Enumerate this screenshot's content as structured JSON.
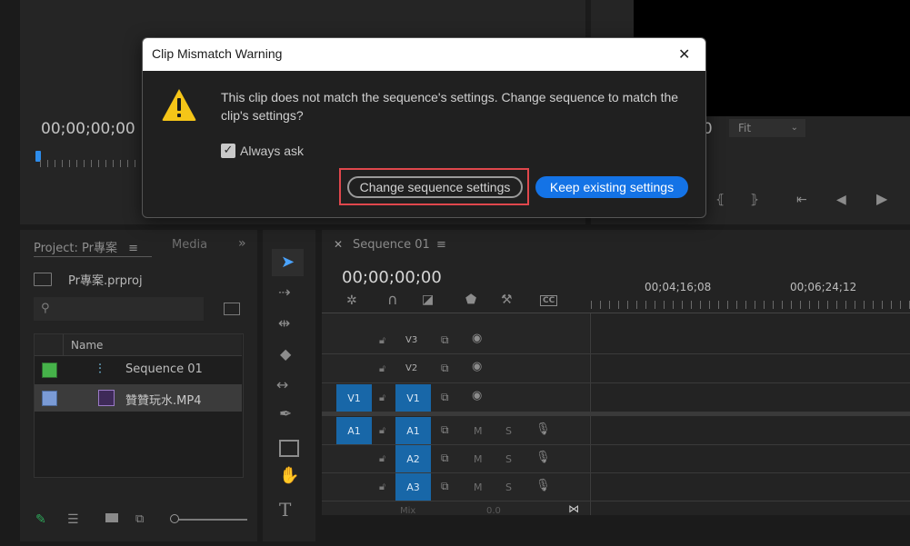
{
  "source_monitor": {
    "timecode": "00;00;00;00"
  },
  "program_monitor": {
    "timecode_partial": "00",
    "zoom": "Fit"
  },
  "project": {
    "tab_label": "Project: Pr專案",
    "tab_media": "Media",
    "file_name": "Pr專案.prproj",
    "column_name": "Name",
    "items": [
      {
        "name": "Sequence 01",
        "color": "#46b34a"
      },
      {
        "name": "贊贊玩水.MP4",
        "color": "#7a9bd6"
      }
    ]
  },
  "timeline": {
    "tab_label": "Sequence 01",
    "timecode": "00;00;00;00",
    "ruler_marks": [
      "00;04;16;08",
      "00;06;24;12"
    ],
    "video_tracks": [
      "V3",
      "V2",
      "V1"
    ],
    "audio_tracks": [
      "A1",
      "A2",
      "A3"
    ],
    "source_v": "V1",
    "source_a": "A1",
    "mute_label": "M",
    "solo_label": "S",
    "mix_label": "Mix",
    "mix_value": "0.0"
  },
  "dialog": {
    "title": "Clip Mismatch Warning",
    "message": "This clip does not match the sequence's settings. Change sequence to match the clip's settings?",
    "checkbox_label": "Always ask",
    "checkbox_checked": true,
    "btn_change": "Change sequence settings",
    "btn_keep": "Keep existing settings",
    "close_symbol": "✕"
  },
  "colors": {
    "accent": "#1473e6",
    "highlight_box": "#e0474c",
    "warning": "#f5c518"
  }
}
